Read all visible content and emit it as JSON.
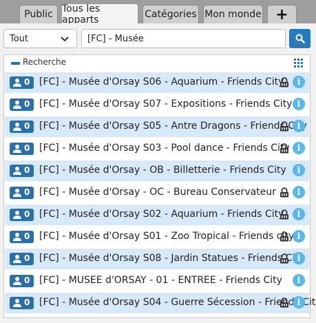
{
  "tabs": [
    {
      "label": "Public",
      "active": false
    },
    {
      "label": "Tous les apparts",
      "active": true
    },
    {
      "label": "Catégories",
      "active": false
    },
    {
      "label": "Mon monde",
      "active": false
    },
    {
      "label": "+",
      "active": false
    }
  ],
  "filter": {
    "selected": "Tout"
  },
  "search": {
    "value": "[FC] - Musée",
    "icon": "search-icon"
  },
  "results": {
    "header_label": "Recherche",
    "rows": [
      {
        "count": "0",
        "title": "[FC] - Musée d'Orsay S06 - Aquarium - Friends City",
        "locked": true
      },
      {
        "count": "0",
        "title": "[FC] - Musée d'Orsay S07 - Expositions - Friends City",
        "locked": false
      },
      {
        "count": "0",
        "title": "[FC] - Musée d'Orsay S05 - Antre Dragons - Friends City",
        "locked": true
      },
      {
        "count": "0",
        "title": "[FC] - Musée d'Orsay S03 - Pool dance - Friends City",
        "locked": true
      },
      {
        "count": "0",
        "title": "[FC] - Musée d'Orsay - OB - Billetterie - Friends City",
        "locked": false
      },
      {
        "count": "0",
        "title": "[FC] - Musée d'Orsay - OC - Bureau Conservateur",
        "locked": true
      },
      {
        "count": "0",
        "title": "[FC] - Musée d'Orsay S02 - Aquarium - Friends City",
        "locked": true
      },
      {
        "count": "0",
        "title": "[FC] - Musée d'Orsay S01 - Zoo Tropical - Friends city",
        "locked": true
      },
      {
        "count": "0",
        "title": "[FC] - Musée d'Orsay S08 - Jardin Statues - Friends City",
        "locked": true
      },
      {
        "count": "0",
        "title": "[FC] - MUSEE d'ORSAY - 01 - ENTREE - Friends City",
        "locked": false
      },
      {
        "count": "0",
        "title": "[FC] - Musée d'Orsay S04 - Guerre Sécession - Friends City",
        "locked": true
      }
    ]
  },
  "colors": {
    "accent": "#2c70a6",
    "row_highlight": "#d7e9f8",
    "info": "#5bb6ec"
  }
}
